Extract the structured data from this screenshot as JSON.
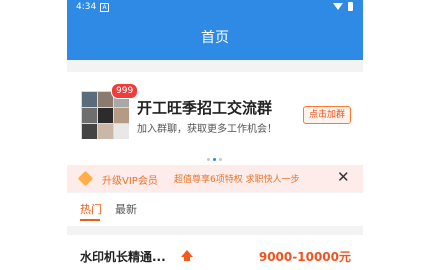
{
  "status_bar": {
    "time": "4:34",
    "notification_glyph": "A"
  },
  "app_bar": {
    "title": "首页"
  },
  "banner": {
    "badge_count": "999",
    "title": "开工旺季招工交流群",
    "subtitle": "加入群聊，获取更多工作机会！",
    "join_label": "点击加群",
    "carousel_active_index": 1,
    "carousel_total": 3
  },
  "vip_bar": {
    "label": "升级VIP会员",
    "description": "超值尊享6项特权 求职快人一步",
    "close_label": "✕"
  },
  "tabs": [
    {
      "label": "热门",
      "active": true
    },
    {
      "label": "最新",
      "active": false
    }
  ],
  "jobs": [
    {
      "title": "水印机长精通...",
      "promoted": true,
      "salary": "9000-10000元"
    }
  ],
  "colors": {
    "app_blue": "#2f8ae6",
    "accent_orange": "#f5511e",
    "vip_bg": "#fdecea",
    "badge_red": "#f23b3b"
  },
  "icons": [
    "notification-icon",
    "wifi-icon",
    "battery-icon",
    "group-avatar-icon",
    "diamond-icon",
    "close-icon",
    "boost-up-icon"
  ]
}
